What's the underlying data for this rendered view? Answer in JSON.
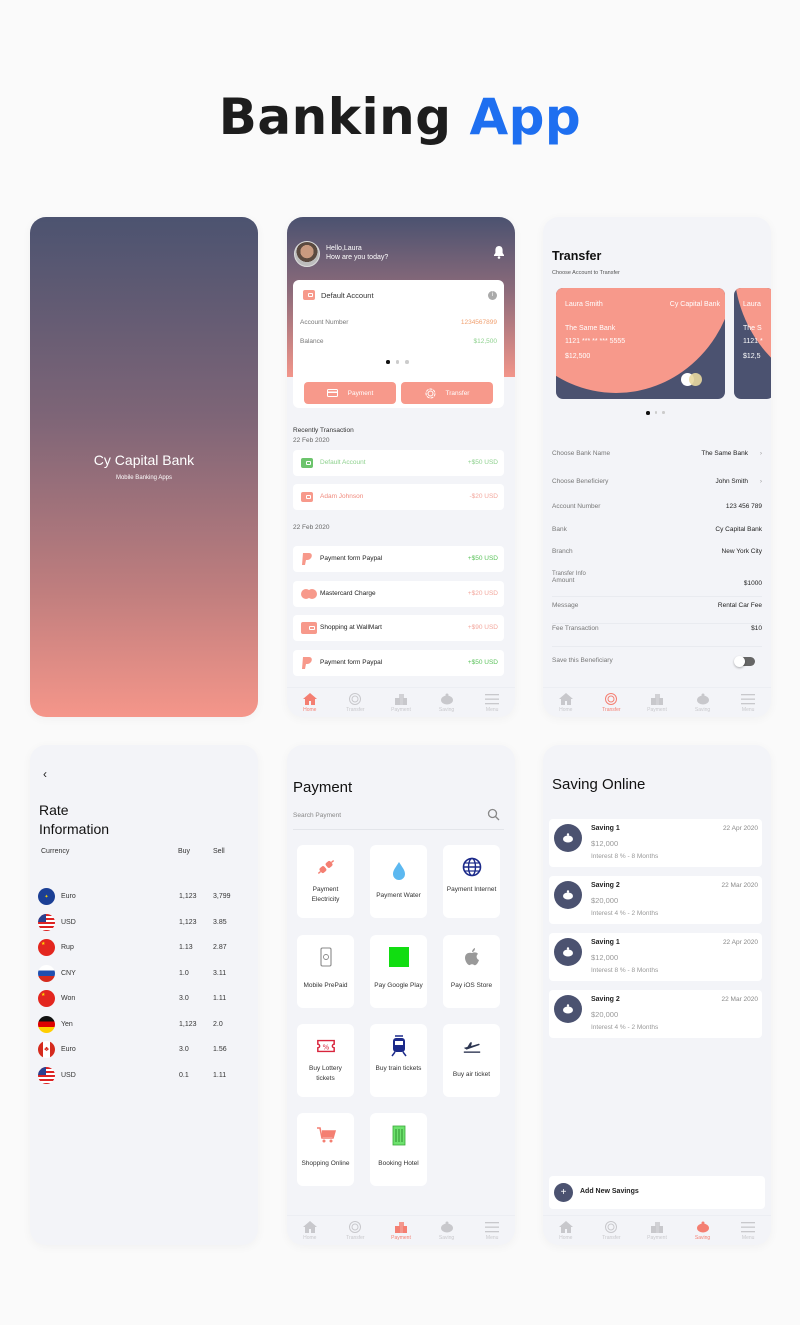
{
  "title": {
    "main": "Banking",
    "accent": "App"
  },
  "colors": {
    "accent_blue": "#1e6ff0",
    "coral": "#f7998b",
    "navy": "#4b5270",
    "green": "#5cc35c"
  },
  "splash": {
    "bank_name": "Cy Capital Bank",
    "tagline": "Mobile Banking Apps"
  },
  "home": {
    "greeting_line1": "Hello,Laura",
    "greeting_line2": "How are you today?",
    "account": {
      "title": "Default Account",
      "account_number_label": "Account Number",
      "account_number": "1234567899",
      "balance_label": "Balance",
      "balance": "$12,500"
    },
    "buttons": {
      "payment": "Payment",
      "transfer": "Transfer"
    },
    "recent_title": "Recently Transaction",
    "groups": [
      {
        "date": "22 Feb 2020",
        "items": [
          {
            "name": "Default Account",
            "amount": "+$50 USD",
            "icon": "wallet-icon"
          },
          {
            "name": "Adam Johnson",
            "amount": "-$20 USD",
            "icon": "wallet-icon"
          }
        ]
      },
      {
        "date": "22 Feb 2020",
        "items": [
          {
            "name": "Payment form Paypal",
            "amount": "+$50 USD",
            "icon": "paypal-icon"
          },
          {
            "name": "Mastercard Charge",
            "amount": "+$20 USD",
            "icon": "mastercard-icon"
          },
          {
            "name": "Shopping at WallMart",
            "amount": "+$90 USD",
            "icon": "wallet-icon"
          },
          {
            "name": "Payment form Paypal",
            "amount": "+$50 USD",
            "icon": "paypal-icon"
          }
        ]
      }
    ]
  },
  "nav": {
    "home": "Home",
    "transfer": "Transfer",
    "payment": "Payment",
    "saving": "Saving",
    "menu": "Menu"
  },
  "transfer": {
    "title": "Transfer",
    "subtitle": "Choose Account to Transfer",
    "card": {
      "holder": "Laura Smith",
      "bank": "Cy Capital Bank",
      "bank_name": "The Same Bank",
      "number": "1121 *** ** *** 5555",
      "balance": "$12,500"
    },
    "card2": {
      "holder": "Laura",
      "bank_name": "The S",
      "number": "1121 *",
      "balance": "$12,5"
    },
    "fields": [
      {
        "label": "Choose Bank Name",
        "value": "The Same Bank",
        "chevron": true
      },
      {
        "label": "Choose Beneficiery",
        "value": "John Smith",
        "chevron": true
      },
      {
        "label": "Account Number",
        "value": "123 456 789"
      },
      {
        "label": "Bank",
        "value": "Cy Capital Bank"
      },
      {
        "label": "Branch",
        "value": "New York City"
      },
      {
        "label": "Transfer Info",
        "label2": "Amount",
        "value": "$1000"
      },
      {
        "label": "Message",
        "value": "Rental Car Fee"
      },
      {
        "label": "Fee Transaction",
        "value": "$10"
      }
    ],
    "save_beneficiary": "Save this Beneficiary",
    "save_beneficiary_on": false
  },
  "rates": {
    "title_line1": "Rate",
    "title_line2": "Information",
    "headers": {
      "currency": "Currency",
      "buy": "Buy",
      "sell": "Sell"
    },
    "rows": [
      {
        "flag": "eu",
        "currency": "Euro",
        "buy": "1,123",
        "sell": "3,799"
      },
      {
        "flag": "us",
        "currency": "USD",
        "buy": "1,123",
        "sell": "3.85"
      },
      {
        "flag": "cn",
        "currency": "Rup",
        "buy": "1.13",
        "sell": "2.87"
      },
      {
        "flag": "ru",
        "currency": "CNY",
        "buy": "1.0",
        "sell": "3.11"
      },
      {
        "flag": "cn",
        "currency": "Won",
        "buy": "3.0",
        "sell": "1.11"
      },
      {
        "flag": "de",
        "currency": "Yen",
        "buy": "1,123",
        "sell": "2.0"
      },
      {
        "flag": "ca",
        "currency": "Euro",
        "buy": "3.0",
        "sell": "1.56"
      },
      {
        "flag": "us",
        "currency": "USD",
        "buy": "0.1",
        "sell": "1.11"
      }
    ]
  },
  "payment": {
    "title": "Payment",
    "search_placeholder": "Search Payment",
    "tiles": [
      {
        "label": "Payment Electricity",
        "icon": "plug-icon"
      },
      {
        "label": "Payment Water",
        "icon": "water-drop-icon"
      },
      {
        "label": "Payment Internet",
        "icon": "globe-icon"
      },
      {
        "label": "Mobile PrePaid",
        "icon": "mobile-icon"
      },
      {
        "label": "Pay Google Play",
        "icon": "google-play-icon"
      },
      {
        "label": "Pay iOS Store",
        "icon": "apple-icon"
      },
      {
        "label": "Buy Lottery tickets",
        "icon": "ticket-icon"
      },
      {
        "label": "Buy train tickets",
        "icon": "train-icon"
      },
      {
        "label": "Buy air ticket",
        "icon": "plane-icon"
      },
      {
        "label": "Shopping Online",
        "icon": "cart-icon"
      },
      {
        "label": "Booking Hotel",
        "icon": "hotel-icon"
      }
    ]
  },
  "saving": {
    "title": "Saving Online",
    "items": [
      {
        "name": "Saving 1",
        "date": "22 Apr 2020",
        "amount": "$12,000",
        "interest": "Interest 8 % - 8 Months"
      },
      {
        "name": "Saving 2",
        "date": "22 Mar 2020",
        "amount": "$20,000",
        "interest": "Interest 4 % - 2 Months"
      },
      {
        "name": "Saving 1",
        "date": "22 Apr 2020",
        "amount": "$12,000",
        "interest": "Interest 8 % - 8 Months"
      },
      {
        "name": "Saving 2",
        "date": "22 Mar 2020",
        "amount": "$20,000",
        "interest": "Interest 4 % - 2 Months"
      }
    ],
    "add_label": "Add New Savings"
  }
}
